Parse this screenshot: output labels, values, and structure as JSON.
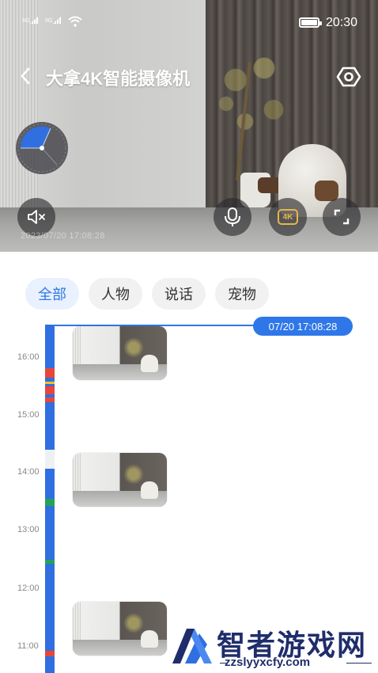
{
  "status_bar": {
    "signal_1": "5G",
    "signal_2": "5G",
    "time": "20:30"
  },
  "header": {
    "title": "大拿4K智能摄像机",
    "back_icon": "chevron-left-icon",
    "settings_icon": "hexagon-settings-icon"
  },
  "video": {
    "overlay_timestamp": "2023/07/20 17:08:28",
    "controls": {
      "mute_icon": "speaker-mute-icon",
      "mic_icon": "microphone-icon",
      "quality_label": "4K",
      "fullscreen_icon": "fullscreen-icon"
    }
  },
  "filters": {
    "tabs": [
      {
        "label": "全部",
        "active": true
      },
      {
        "label": "人物",
        "active": false
      },
      {
        "label": "说话",
        "active": false
      },
      {
        "label": "宠物",
        "active": false
      }
    ]
  },
  "timeline": {
    "current_time": "07/20 17:08:28",
    "hour_labels": [
      "16:00",
      "15:00",
      "14:00",
      "13:00",
      "12:00",
      "11:00"
    ]
  },
  "watermark": {
    "name": "智者游戏网",
    "url": "zzslyyxcfy.com"
  },
  "colors": {
    "accent": "#2f77e9",
    "track_blue": "#2f6fe0",
    "event_red": "#e8463a",
    "event_yellow": "#f5c21b",
    "event_green": "#23a455",
    "quality_gold": "#e8b54a"
  }
}
